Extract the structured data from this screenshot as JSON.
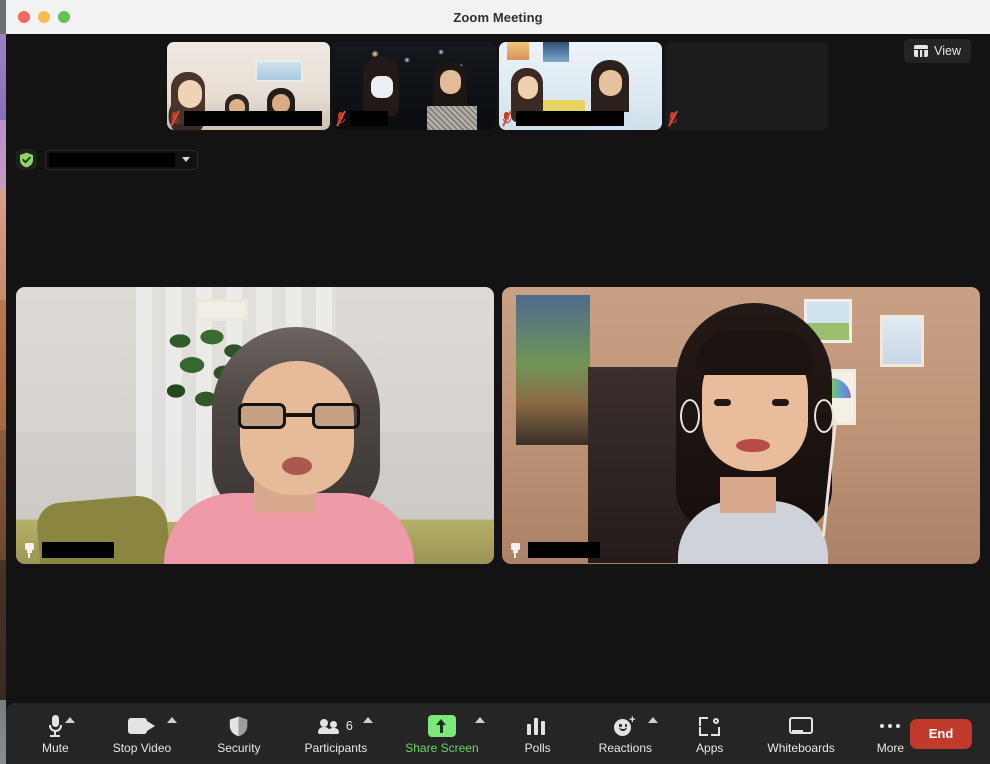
{
  "window": {
    "title": "Zoom Meeting",
    "traffic_lights": [
      {
        "name": "close",
        "color": "#ee6a5f"
      },
      {
        "name": "minimize",
        "color": "#f5bd4f"
      },
      {
        "name": "maximize",
        "color": "#61c554"
      }
    ]
  },
  "stage": {
    "view_button": {
      "label": "View",
      "icon": "layout-grid-icon"
    },
    "encryption_badge": {
      "icon": "shield-check-icon",
      "color": "#8fd46a"
    },
    "meeting_info": {
      "value": "",
      "caret_icon": "chevron-down-icon"
    }
  },
  "filmstrip": [
    {
      "name": "thumbnail-1",
      "display_name": "",
      "muted": true,
      "video_on": true
    },
    {
      "name": "thumbnail-2",
      "display_name": "",
      "muted": true,
      "video_on": true
    },
    {
      "name": "thumbnail-3",
      "display_name": "",
      "muted": true,
      "video_on": true
    },
    {
      "name": "thumbnail-4",
      "display_name": "",
      "muted": true,
      "video_on": false
    }
  ],
  "main_tiles": [
    {
      "name": "main-tile-1",
      "display_name": "",
      "pinned": true,
      "active_speaker": true
    },
    {
      "name": "main-tile-2",
      "display_name": "",
      "pinned": true,
      "active_speaker": false
    }
  ],
  "toolbar": {
    "mute": {
      "label": "Mute",
      "icon": "microphone-icon",
      "has_menu": true
    },
    "video": {
      "label": "Stop Video",
      "icon": "camera-icon",
      "has_menu": true
    },
    "security": {
      "label": "Security",
      "icon": "shield-icon",
      "has_menu": false
    },
    "participants": {
      "label": "Participants",
      "icon": "people-icon",
      "count": "6",
      "has_menu": true
    },
    "share": {
      "label": "Share Screen",
      "icon": "share-arrow-icon",
      "has_menu": true,
      "accent": "#7ce87a"
    },
    "polls": {
      "label": "Polls",
      "icon": "bar-chart-icon",
      "has_menu": false
    },
    "reactions": {
      "label": "Reactions",
      "icon": "smiley-plus-icon",
      "has_menu": true
    },
    "apps": {
      "label": "Apps",
      "icon": "apps-icon",
      "has_menu": false
    },
    "whiteboards": {
      "label": "Whiteboards",
      "icon": "whiteboard-icon",
      "has_menu": false
    },
    "more": {
      "label": "More",
      "icon": "ellipsis-icon",
      "has_menu": false
    },
    "end": {
      "label": "End",
      "color": "#c0392b"
    }
  }
}
